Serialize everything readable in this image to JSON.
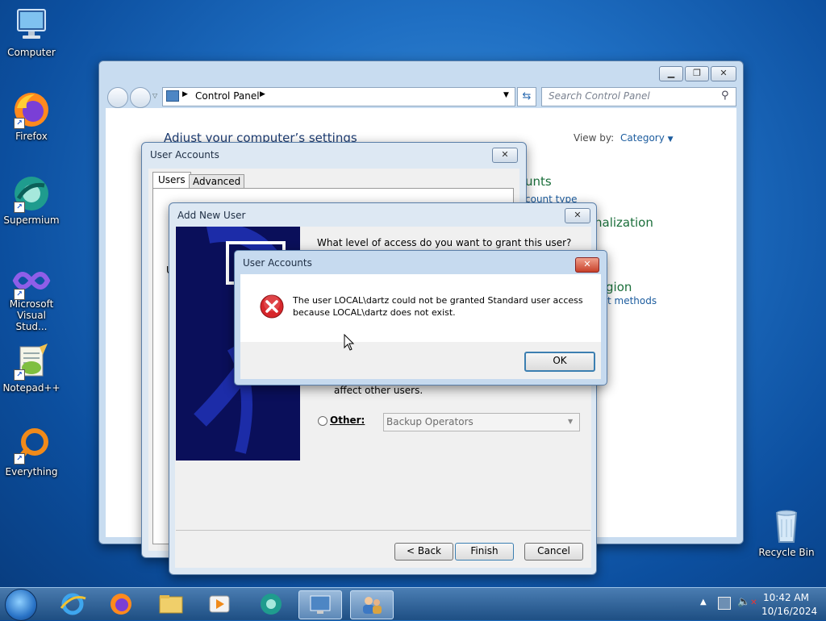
{
  "desktop": {
    "icons": [
      {
        "label": "Computer",
        "icon": "computer-icon"
      },
      {
        "label": "Firefox",
        "icon": "firefox-icon"
      },
      {
        "label": "Supermium",
        "icon": "supermium-icon"
      },
      {
        "label": "Microsoft Visual Stud...",
        "icon": "visual-studio-icon"
      },
      {
        "label": "Notepad++",
        "icon": "notepadpp-icon"
      },
      {
        "label": "Everything",
        "icon": "everything-icon"
      },
      {
        "label": "Recycle Bin",
        "icon": "recycle-bin-icon"
      }
    ]
  },
  "control_panel": {
    "breadcrumb": "Control Panel",
    "search_placeholder": "Search Control Panel",
    "heading": "Adjust your computer’s settings",
    "view_by_label": "View by:",
    "view_by_value": "Category",
    "right_fragments": [
      "unts",
      "count type",
      "nalization",
      "gion",
      "t methods"
    ]
  },
  "user_accounts_window": {
    "title": "User Accounts",
    "tabs": [
      "Users",
      "Advanced"
    ],
    "stray_text": "U"
  },
  "add_new_user": {
    "title": "Add New User",
    "question": "What level of access do you want to grant this user?",
    "partial_text": "affect other users.",
    "other_label": "Other:",
    "other_value": "Backup Operators",
    "back_button": "< Back",
    "finish_button": "Finish",
    "cancel_button": "Cancel"
  },
  "error_dialog": {
    "title": "User Accounts",
    "message_line1": "The user LOCAL\\dartz could not be granted Standard user access",
    "message_line2": "because LOCAL\\dartz does not exist.",
    "ok_button": "OK"
  },
  "taskbar": {
    "time": "10:42 AM",
    "date": "10/16/2024",
    "items": [
      "start-orb-icon",
      "internet-explorer-icon",
      "firefox-icon",
      "file-explorer-icon",
      "media-player-icon",
      "supermium-icon",
      "control-panel-icon",
      "user-accounts-icon"
    ]
  },
  "colors": {
    "desktop_blue": "#1f6fc3",
    "link_blue": "#1c5c9e",
    "error_red": "#d7262b"
  }
}
